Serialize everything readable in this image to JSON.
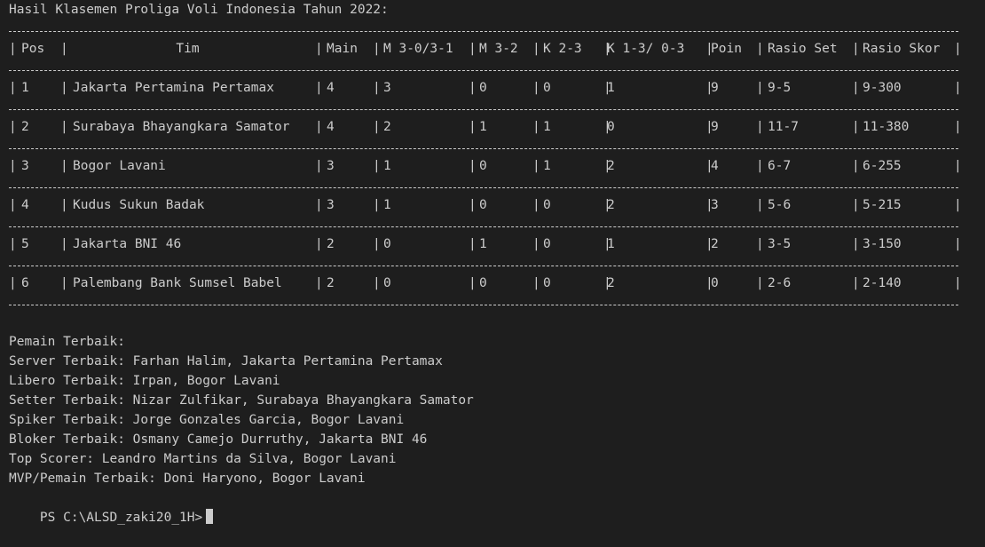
{
  "title": "Hasil Klasemen Proliga Voli Indonesia Tahun 2022:",
  "table": {
    "headers": [
      "Pos",
      "Tim",
      "Main",
      "M 3-0/3-1",
      "M 3-2",
      "K 2-3",
      "K 1-3/ 0-3",
      "Poin",
      "Rasio Set",
      "Rasio Skor"
    ],
    "rows": [
      [
        "1",
        "Jakarta Pertamina Pertamax",
        "4",
        "3",
        "0",
        "0",
        "1",
        "9",
        "9-5",
        "9-300"
      ],
      [
        "2",
        "Surabaya Bhayangkara Samator",
        "4",
        "2",
        "1",
        "1",
        "0",
        "9",
        "11-7",
        "11-380"
      ],
      [
        "3",
        "Bogor Lavani",
        "3",
        "1",
        "0",
        "1",
        "2",
        "4",
        "6-7",
        "6-255"
      ],
      [
        "4",
        "Kudus Sukun Badak",
        "3",
        "1",
        "0",
        "0",
        "2",
        "3",
        "5-6",
        "5-215"
      ],
      [
        "5",
        "Jakarta BNI 46",
        "2",
        "0",
        "1",
        "0",
        "1",
        "2",
        "3-5",
        "3-150"
      ],
      [
        "6",
        "Palembang Bank Sumsel Babel",
        "2",
        "0",
        "0",
        "0",
        "2",
        "0",
        "2-6",
        "2-140"
      ]
    ]
  },
  "awards": {
    "heading": "Pemain Terbaik:",
    "lines": [
      "Server Terbaik: Farhan Halim, Jakarta Pertamina Pertamax",
      "Libero Terbaik: Irpan, Bogor Lavani",
      "Setter Terbaik: Nizar Zulfikar, Surabaya Bhayangkara Samator",
      "Spiker Terbaik: Jorge Gonzales Garcia, Bogor Lavani",
      "Bloker Terbaik: Osmany Camejo Durruthy, Jakarta BNI 46",
      "Top Scorer: Leandro Martins da Silva, Bogor Lavani",
      "MVP/Pemain Terbaik: Doni Haryono, Bogor Lavani"
    ]
  },
  "prompt": "PS C:\\ALSD_zaki20_1H>",
  "colors": {
    "background": "#1e1e1e",
    "foreground": "#cccccc"
  }
}
